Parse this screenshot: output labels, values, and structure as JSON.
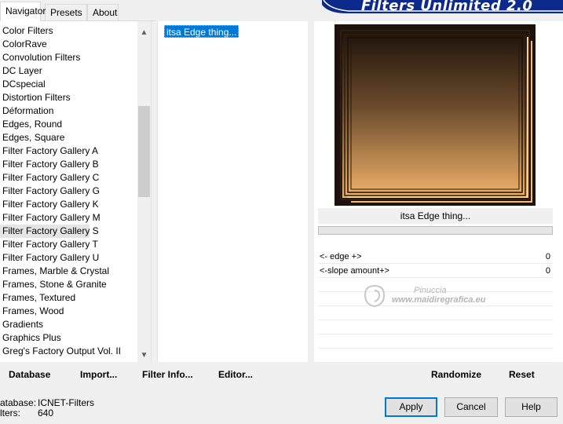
{
  "tabs": [
    {
      "label": "Navigator"
    },
    {
      "label": "Presets"
    },
    {
      "label": "About"
    }
  ],
  "banner": {
    "title": "Filters Unlimited 2.0"
  },
  "categories": [
    "Color Filters",
    "ColorRave",
    "Convolution Filters",
    "DC Layer",
    "DCspecial",
    "Distortion Filters",
    "Déformation",
    "Edges, Round",
    "Edges, Square",
    "Filter Factory Gallery A",
    "Filter Factory Gallery B",
    "Filter Factory Gallery C",
    "Filter Factory Gallery G",
    "Filter Factory Gallery K",
    "Filter Factory Gallery M",
    "Filter Factory Gallery S",
    "Filter Factory Gallery T",
    "Filter Factory Gallery U",
    "Frames, Marble & Crystal",
    "Frames, Stone & Granite",
    "Frames, Textured",
    "Frames, Wood",
    "Gradients",
    "Graphics Plus",
    "Greg's Factory Output Vol. II"
  ],
  "selected_category": "Filter Factory Gallery S",
  "filters": [
    "itsa Edge thing..."
  ],
  "selected_filter": "itsa Edge thing...",
  "preview": {
    "filter_name": "itsa Edge thing..."
  },
  "params": [
    {
      "label": "<- edge +>",
      "value": "0"
    },
    {
      "label": "<-slope amount+>",
      "value": "0"
    }
  ],
  "watermark": {
    "line1": "Pinuccia",
    "line2": "www.maidiregrafica.eu"
  },
  "buttons": {
    "database": "Database",
    "import": "Import...",
    "filter_info": "Filter Info...",
    "editor": "Editor...",
    "randomize": "Randomize",
    "reset": "Reset",
    "apply": "Apply",
    "cancel": "Cancel",
    "help": "Help"
  },
  "footer": {
    "database_label": "atabase:",
    "database_value": "ICNET-Filters",
    "filters_label": "lters:",
    "filters_value": "640"
  },
  "colors": {
    "banner": "#0b2a8c",
    "selection": "#0078d7",
    "preview_dark": "#1d1209",
    "preview_light": "#f2b36a"
  }
}
